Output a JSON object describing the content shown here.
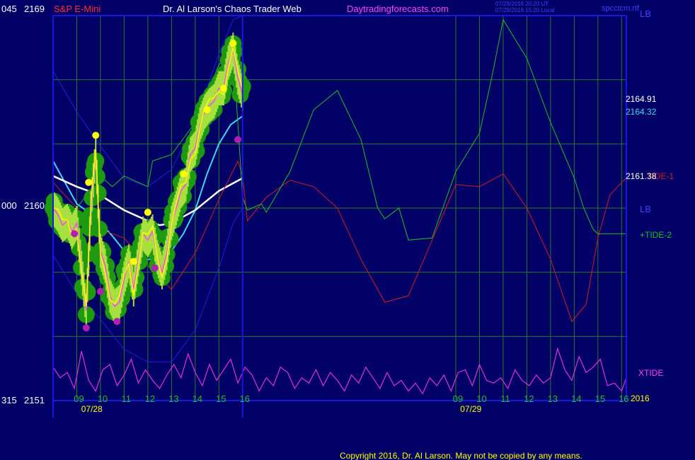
{
  "header": {
    "symbol": "S&P E-Mini",
    "title": "Dr. Al Larson's Chaos Trader Web",
    "site": "Daytradingforecasts.com",
    "time_ut": "07/29/2016 20:20 UT",
    "time_local": "07/29/2016 15:20 Local",
    "spacetime": "spcctcm.rtf"
  },
  "footer": {
    "copyright": "Copyright 2016, Dr. Al Larson. May not be copied by any means."
  },
  "colors": {
    "background": "#000066",
    "grid": "#2a7a2a",
    "axis": "#1818e0",
    "price": "#ffff00",
    "price_inner": "#ff44ff",
    "balls": "#1e9a10",
    "highs": "#ffff00",
    "lows": "#b020b0",
    "ma_short": "#40d8f0",
    "ma_long": "#ffffff",
    "bands": "#2020e0",
    "tide1": "#d02020",
    "tide2": "#20c020",
    "xtide": "#e030e0"
  },
  "chart_data": {
    "type": "line",
    "title": "Dr. Al Larson's Chaos Trader Web",
    "symbol": "S&P E-Mini",
    "ylim": [
      2151,
      2169
    ],
    "left_scale_labels": [
      {
        "left": "045",
        "right": "2169"
      },
      {
        "left": "000",
        "right": "2160"
      },
      {
        "left": "315",
        "right": "2151"
      }
    ],
    "x_ticks": [
      "09",
      "10",
      "11",
      "12",
      "13",
      "14",
      "15",
      "16",
      "09",
      "10",
      "11",
      "12",
      "13",
      "14",
      "15",
      "16"
    ],
    "x_tick_hours": [
      9,
      10,
      11,
      12,
      13,
      14,
      15,
      16,
      25,
      26,
      27,
      28,
      29,
      30,
      31,
      32
    ],
    "dates": [
      {
        "label": "07/28",
        "hour": 8.5
      },
      {
        "label": "07/29",
        "hour": 24.5
      }
    ],
    "year_label": "2016",
    "now_hour": 16,
    "price_readouts": [
      {
        "label": "2164.91",
        "color": "#ffffff"
      },
      {
        "label": "2164.32",
        "color": "#40d8f0"
      },
      {
        "label": "2161.38",
        "color": "#ffffff"
      }
    ],
    "legend": [
      {
        "label": "LB",
        "color": "#4040ff"
      },
      {
        "label": "TIDE-1",
        "color": "#d02020"
      },
      {
        "label": "LB",
        "color": "#4040ff"
      },
      {
        "label": "+TIDE-2",
        "color": "#20c020"
      },
      {
        "label": "XTIDE",
        "color": "#e030e0"
      }
    ],
    "series": [
      {
        "name": "Price",
        "x": [
          8.0,
          8.2,
          8.4,
          8.6,
          8.8,
          9.0,
          9.2,
          9.4,
          9.6,
          9.8,
          10.0,
          10.2,
          10.4,
          10.6,
          10.8,
          11.0,
          11.2,
          11.4,
          11.6,
          11.8,
          12.0,
          12.2,
          12.4,
          12.6,
          12.8,
          13.0,
          13.2,
          13.4,
          13.6,
          13.8,
          14.0,
          14.2,
          14.4,
          14.6,
          14.8,
          15.0,
          15.2,
          15.4,
          15.6,
          15.8,
          16.0
        ],
        "y": [
          2160.0,
          2159.7,
          2159.2,
          2159.4,
          2158.9,
          2159.3,
          2157.2,
          2155.2,
          2160.0,
          2162.6,
          2158.0,
          2157.3,
          2155.9,
          2155.4,
          2155.6,
          2156.7,
          2157.5,
          2156.2,
          2157.6,
          2158.8,
          2158.5,
          2158.9,
          2157.7,
          2157.0,
          2157.9,
          2159.3,
          2160.0,
          2160.8,
          2161.1,
          2162.5,
          2162.8,
          2163.9,
          2164.5,
          2164.8,
          2165.0,
          2165.6,
          2165.6,
          2166.8,
          2167.4,
          2166.1,
          2165.3
        ]
      },
      {
        "name": "MA-fast",
        "x": [
          8.0,
          8.5,
          9.0,
          9.5,
          10.0,
          10.5,
          11.0,
          11.5,
          12.0,
          12.5,
          13.0,
          13.5,
          14.0,
          14.5,
          15.0,
          15.5,
          16.0
        ],
        "y": [
          2162.2,
          2161.2,
          2160.2,
          2159.8,
          2159.3,
          2158.7,
          2158.0,
          2157.5,
          2157.6,
          2157.6,
          2158.0,
          2158.8,
          2159.9,
          2161.6,
          2163.0,
          2163.9,
          2164.3
        ]
      },
      {
        "name": "MA-slow",
        "x": [
          8.0,
          9.0,
          10.0,
          11.0,
          12.0,
          12.5,
          13.0,
          14.0,
          15.0,
          16.0
        ],
        "y": [
          2161.5,
          2161.0,
          2160.6,
          2159.9,
          2159.4,
          2159.2,
          2159.3,
          2159.9,
          2160.8,
          2161.4
        ]
      },
      {
        "name": "Band-upper",
        "x": [
          8.0,
          9.0,
          10.0,
          11.0,
          12.0,
          13.0,
          14.0,
          15.0,
          15.6,
          16.0
        ],
        "y": [
          2166.4,
          2164.5,
          2162.9,
          2161.4,
          2161.0,
          2161.8,
          2164.0,
          2167.2,
          2168.8,
          2169.0
        ]
      },
      {
        "name": "Band-lower",
        "x": [
          8.0,
          9.0,
          10.0,
          11.0,
          12.0,
          13.0,
          14.0,
          15.0,
          15.6,
          16.0
        ],
        "y": [
          2157.8,
          2156.0,
          2154.8,
          2153.4,
          2152.8,
          2152.8,
          2154.3,
          2157.2,
          2159.3,
          2160.0
        ]
      },
      {
        "name": "TIDE-1",
        "x": [
          8.0,
          9.0,
          10.0,
          11.0,
          12.0,
          13.0,
          14.0,
          15.0,
          15.8,
          16.0,
          16.2,
          17.0,
          18.0,
          19.0,
          20.0,
          21.0,
          22.0,
          23.0,
          24.0,
          25.0,
          26.0,
          27.0,
          28.0,
          29.0,
          29.9,
          30.5,
          31.0,
          31.5,
          32.0,
          32.2
        ],
        "y": [
          2161.2,
          2160.0,
          2159.0,
          2158.6,
          2157.3,
          2156.2,
          2157.9,
          2160.4,
          2162.2,
          2161.5,
          2159.4,
          2160.5,
          2161.3,
          2161.0,
          2160.0,
          2157.6,
          2155.6,
          2155.9,
          2158.5,
          2161.1,
          2161.0,
          2161.6,
          2160.0,
          2157.6,
          2154.7,
          2155.5,
          2158.6,
          2160.6,
          2161.2,
          2161.4
        ]
      },
      {
        "name": "+TIDE-2",
        "x": [
          8.0,
          9.0,
          10.0,
          10.5,
          11.0,
          12.0,
          12.2,
          13.0,
          14.0,
          15.0,
          15.6,
          16.0,
          16.2,
          16.8,
          17.0,
          18.0,
          19.0,
          20.0,
          21.0,
          21.7,
          22.0,
          22.6,
          23.0,
          24.0,
          25.0,
          26.0,
          26.5,
          27.0,
          28.0,
          29.0,
          30.0,
          30.4,
          30.8,
          31.0,
          31.6,
          32.2
        ],
        "y": [
          2159.2,
          2160.0,
          2161.5,
          2161.0,
          2161.5,
          2161.0,
          2162.2,
          2162.5,
          2164.0,
          2166.7,
          2167.4,
          2160.5,
          2159.9,
          2160.2,
          2159.8,
          2161.7,
          2164.6,
          2165.5,
          2163.2,
          2160.0,
          2159.5,
          2160.0,
          2158.5,
          2158.6,
          2161.7,
          2163.5,
          2166.0,
          2168.8,
          2167.0,
          2164.0,
          2161.4,
          2160.0,
          2159.0,
          2158.8,
          2158.8,
          2158.8
        ]
      }
    ],
    "xtide": {
      "name": "XTIDE",
      "x": [
        8.0,
        8.3,
        8.6,
        8.9,
        9.2,
        9.5,
        9.8,
        10.1,
        10.4,
        10.7,
        11.0,
        11.3,
        11.6,
        11.9,
        12.2,
        12.5,
        12.8,
        13.1,
        13.4,
        13.7,
        14.0,
        14.3,
        14.6,
        14.9,
        15.2,
        15.5,
        15.8,
        16.1,
        16.4,
        16.7,
        17.0,
        17.3,
        17.6,
        17.9,
        18.2,
        18.5,
        18.8,
        19.1,
        19.4,
        19.7,
        20.0,
        20.3,
        20.6,
        20.9,
        21.2,
        21.5,
        21.8,
        22.1,
        22.4,
        22.7,
        23.0,
        23.3,
        23.6,
        23.9,
        24.2,
        24.5,
        24.8,
        25.1,
        25.4,
        25.7,
        26.0,
        26.3,
        26.6,
        26.9,
        27.2,
        27.5,
        27.8,
        28.1,
        28.4,
        28.7,
        29.0,
        29.3,
        29.6,
        29.9,
        30.2,
        30.5,
        30.8,
        31.1,
        31.4,
        31.7,
        32.0,
        32.2
      ],
      "y": [
        0.55,
        0.35,
        0.45,
        0.15,
        0.85,
        0.3,
        0.1,
        0.5,
        0.6,
        0.2,
        0.4,
        0.7,
        0.25,
        0.5,
        0.3,
        0.15,
        0.4,
        0.6,
        0.35,
        0.8,
        0.45,
        0.2,
        0.6,
        0.3,
        0.5,
        0.7,
        0.25,
        0.55,
        0.4,
        0.1,
        0.35,
        0.2,
        0.55,
        0.45,
        0.15,
        0.35,
        0.25,
        0.5,
        0.2,
        0.45,
        0.3,
        0.1,
        0.4,
        0.25,
        0.55,
        0.35,
        0.15,
        0.45,
        0.2,
        0.3,
        0.1,
        0.25,
        0.05,
        0.35,
        0.2,
        0.4,
        0.1,
        0.45,
        0.5,
        0.2,
        0.6,
        0.3,
        0.25,
        0.35,
        0.15,
        0.5,
        0.3,
        0.2,
        0.4,
        0.25,
        0.35,
        0.9,
        0.5,
        0.3,
        0.75,
        0.45,
        0.55,
        0.7,
        0.2,
        0.25,
        0.1,
        0.35
      ]
    },
    "swing_highs": [
      {
        "x": 9.8,
        "y": 2163.4
      },
      {
        "x": 9.5,
        "y": 2161.2
      },
      {
        "x": 11.4,
        "y": 2157.5
      },
      {
        "x": 12.0,
        "y": 2159.8
      },
      {
        "x": 13.5,
        "y": 2161.6
      },
      {
        "x": 14.5,
        "y": 2164.6
      },
      {
        "x": 15.2,
        "y": 2165.6
      },
      {
        "x": 15.6,
        "y": 2167.7
      }
    ],
    "swing_lows": [
      {
        "x": 9.4,
        "y": 2154.4
      },
      {
        "x": 10.0,
        "y": 2156.1
      },
      {
        "x": 10.7,
        "y": 2154.7
      },
      {
        "x": 12.3,
        "y": 2157.2
      },
      {
        "x": 15.8,
        "y": 2163.2
      },
      {
        "x": 8.9,
        "y": 2158.8
      }
    ]
  }
}
